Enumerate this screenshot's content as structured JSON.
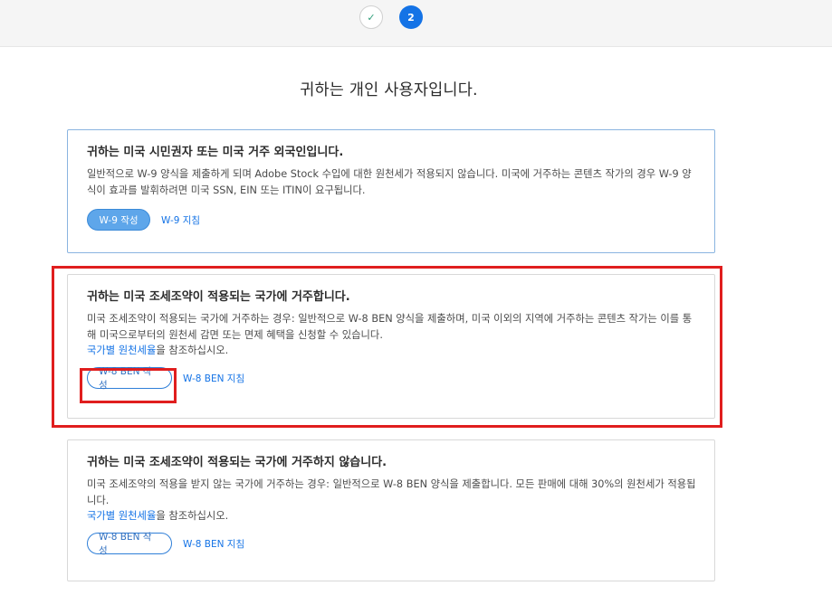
{
  "stepper": {
    "step1_icon": "check-icon",
    "step1_glyph": "✓",
    "step2_label": "2"
  },
  "page_title": "귀하는 개인 사용자입니다.",
  "cards": [
    {
      "title": "귀하는 미국 시민권자 또는 미국 거주 외국인입니다.",
      "description": "일반적으로 W-9 양식을 제출하게 되며 Adobe Stock 수입에 대한 원천세가 적용되지 않습니다. 미국에 거주하는 콘텐츠 작가의 경우 W-9 양식이 효과를 발휘하려면 미국 SSN, EIN 또는 ITIN이 요구됩니다.",
      "button_label": "W-9 작성",
      "guide_label": "W-9 지침"
    },
    {
      "title": "귀하는 미국 조세조약이 적용되는 국가에 거주합니다.",
      "description": "미국 조세조약이 적용되는 국가에 거주하는 경우: 일반적으로 W-8 BEN 양식을 제출하며, 미국 이외의 지역에 거주하는 콘텐츠 작가는 이를 통해 미국으로부터의 원천세 감면 또는 면제 혜택을 신청할 수 있습니다.",
      "link_label": "국가별 원천세율",
      "link_suffix": "을 참조하십시오.",
      "button_label": "W-8 BEN 작성",
      "guide_label": "W-8 BEN 지침"
    },
    {
      "title": "귀하는 미국 조세조약이 적용되는 국가에 거주하지 않습니다.",
      "description": "미국 조세조약의 적용을 받지 않는 국가에 거주하는 경우: 일반적으로 W-8 BEN 양식을 제출합니다. 모든 판매에 대해 30%의 원천세가 적용됩니다.",
      "link_label": "국가별 원천세율",
      "link_suffix": "을 참조하십시오.",
      "button_label": "W-8 BEN 작성",
      "guide_label": "W-8 BEN 지침"
    }
  ],
  "colors": {
    "accent": "#1473e6",
    "highlight": "#e01e1e",
    "filled_button": "#5ea6ea"
  }
}
